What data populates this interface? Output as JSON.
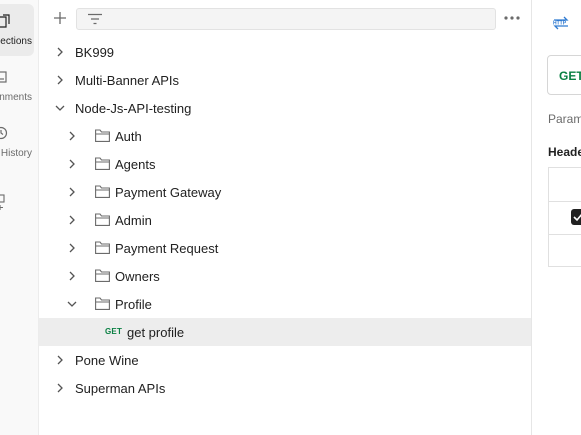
{
  "rail": {
    "items": [
      {
        "label": "Collections",
        "icon": "collections-icon",
        "active": true
      },
      {
        "label": "Environments",
        "icon": "environments-icon",
        "active": false
      },
      {
        "label": "History",
        "icon": "history-icon",
        "active": false
      }
    ],
    "add_icon": "add-workspace-icon"
  },
  "sidebar": {
    "filter_placeholder": "",
    "tree": [
      {
        "label": "BK999",
        "expanded": false
      },
      {
        "label": "Multi-Banner APIs",
        "expanded": false
      },
      {
        "label": "Node-Js-API-testing",
        "expanded": true,
        "children": [
          {
            "label": "Auth",
            "expanded": false
          },
          {
            "label": "Agents",
            "expanded": false
          },
          {
            "label": "Payment Gateway",
            "expanded": false
          },
          {
            "label": "Admin",
            "expanded": false
          },
          {
            "label": "Payment Request",
            "expanded": false
          },
          {
            "label": "Owners",
            "expanded": false
          },
          {
            "label": "Profile",
            "expanded": true,
            "requests": [
              {
                "method": "GET",
                "label": "get profile",
                "selected": true
              }
            ]
          }
        ]
      },
      {
        "label": "Pone Wine",
        "expanded": false
      },
      {
        "label": "Superman APIs",
        "expanded": false
      }
    ]
  },
  "right": {
    "method": "GET",
    "params_label": "Param",
    "headers_label": "Heade",
    "method_color": "#0a8043"
  }
}
